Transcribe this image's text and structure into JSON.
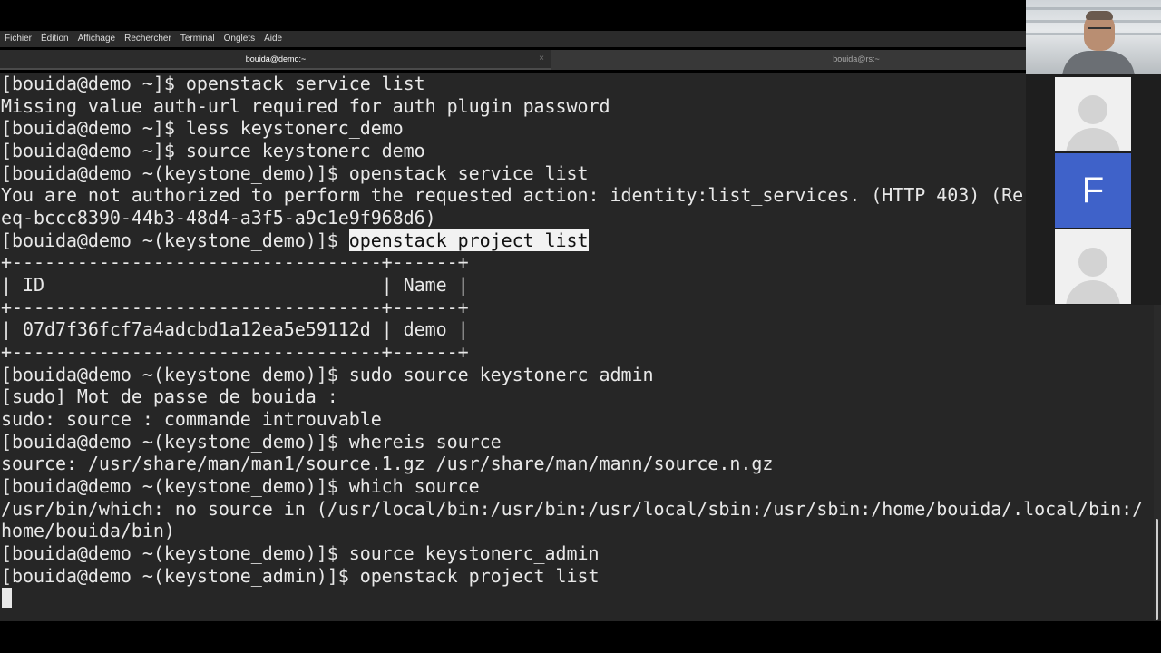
{
  "menu": [
    "Fichier",
    "Édition",
    "Affichage",
    "Rechercher",
    "Terminal",
    "Onglets",
    "Aide"
  ],
  "tabs": [
    {
      "label": "bouida@demo:~",
      "active": true,
      "close_glyph": "×"
    },
    {
      "label": "bouida@rs:~",
      "active": false
    }
  ],
  "terminal": {
    "lines": [
      "[bouida@demo ~]$ openstack service list",
      "Missing value auth-url required for auth plugin password",
      "[bouida@demo ~]$ less keystonerc_demo",
      "[bouida@demo ~]$ source keystonerc_demo",
      "[bouida@demo ~(keystone_demo)]$ openstack service list",
      "You are not authorized to perform the requested action: identity:list_services. (HTTP 403) (Re",
      "eq-bccc8390-44b3-48d4-a3f5-a9c1e9f968d6)",
      "[bouida@demo ~(keystone_demo)]$ ",
      "+----------------------------------+------+",
      "| ID                               | Name |",
      "+----------------------------------+------+",
      "| 07d7f36fcf7a4adcbd1a12ea5e59112d | demo |",
      "+----------------------------------+------+",
      "[bouida@demo ~(keystone_demo)]$ sudo source keystonerc_admin",
      "[sudo] Mot de passe de bouida :",
      "sudo: source : commande introuvable",
      "[bouida@demo ~(keystone_demo)]$ whereis source",
      "source: /usr/share/man/man1/source.1.gz /usr/share/man/mann/source.n.gz",
      "[bouida@demo ~(keystone_demo)]$ which source",
      "/usr/bin/which: no source in (/usr/local/bin:/usr/bin:/usr/local/sbin:/usr/sbin:/home/bouida/.local/bin:/",
      "home/bouida/bin)",
      "[bouida@demo ~(keystone_demo)]$ source keystonerc_admin",
      "[bouida@demo ~(keystone_admin)]$ openstack project list"
    ],
    "selected_text": "openstack project list",
    "selected_line_index": 7
  },
  "call_panel": {
    "letter_avatar": "F",
    "letter_avatar_color": "#3f62c9"
  }
}
